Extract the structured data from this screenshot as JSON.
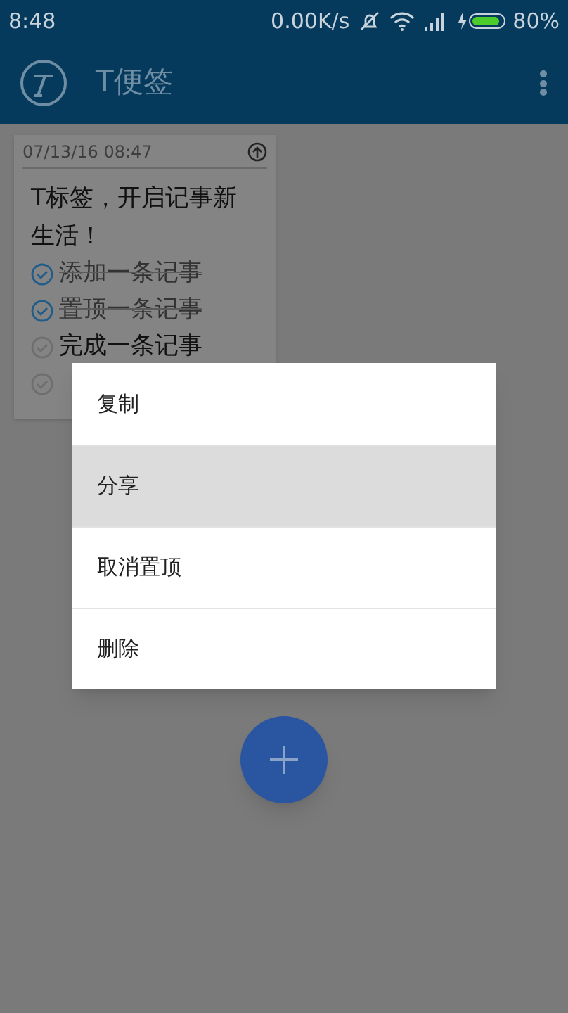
{
  "status_bar": {
    "time": "8:48",
    "speed": "0.00K/s",
    "battery": "80%"
  },
  "app_bar": {
    "title": "T便签"
  },
  "note": {
    "date": "07/13/16 08:47",
    "text": "T标签，开启记事新生活！",
    "items": [
      {
        "text": "添加一条记事",
        "checked": true
      },
      {
        "text": "置顶一条记事",
        "checked": true
      },
      {
        "text": "完成一条记事",
        "checked": false
      },
      {
        "checked": false
      }
    ]
  },
  "menu": [
    {
      "label": "复制",
      "selected": false
    },
    {
      "label": "分享",
      "selected": true
    },
    {
      "label": "取消置顶",
      "selected": false
    },
    {
      "label": "删除",
      "selected": false
    }
  ]
}
